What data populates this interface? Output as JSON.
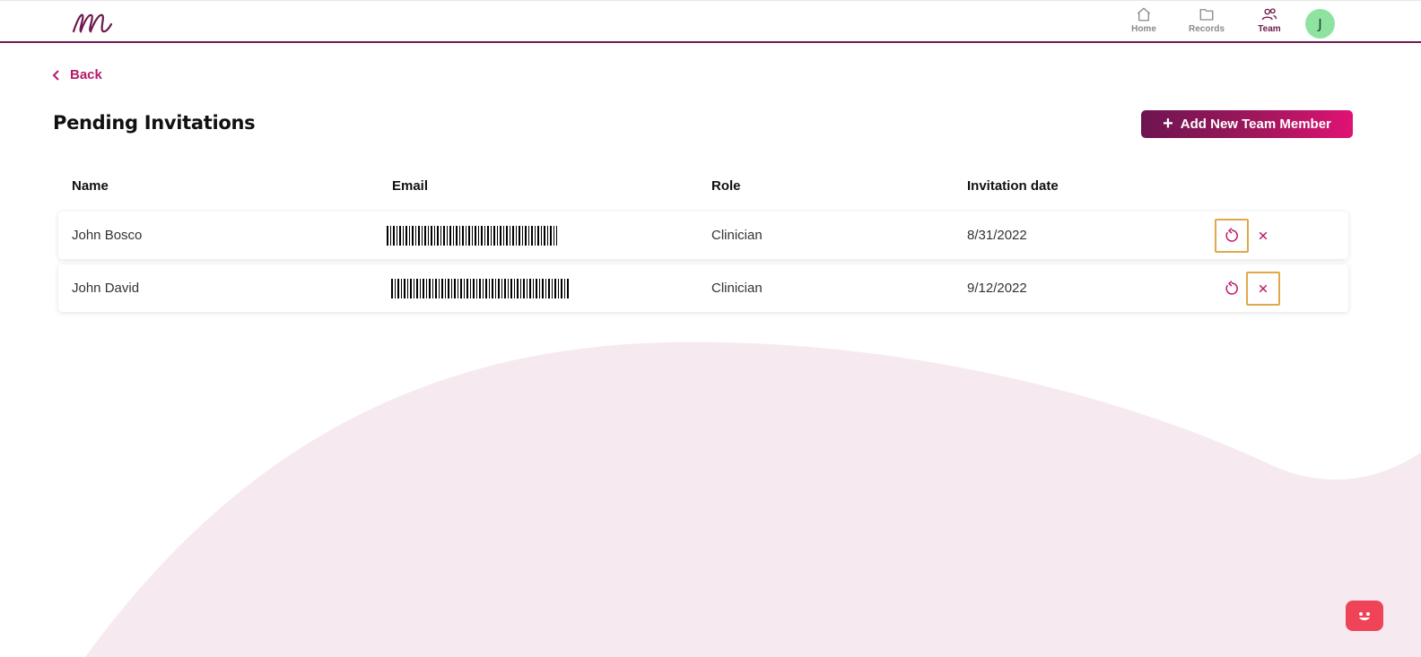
{
  "colors": {
    "brand_dark": "#6d1a4e",
    "brand_accent": "#b51a6b",
    "avatar_bg": "#8fe3a0",
    "highlight": "#e0a84a",
    "chat_bg": "#ef4358"
  },
  "nav": {
    "items": [
      {
        "label": "Home",
        "icon": "home-icon"
      },
      {
        "label": "Records",
        "icon": "folder-icon"
      },
      {
        "label": "Team",
        "icon": "team-icon",
        "active": true
      }
    ],
    "avatar_initial": "J"
  },
  "back_label": "Back",
  "page_title": "Pending Invitations",
  "add_button_label": "Add New Team Member",
  "table": {
    "columns": [
      "Name",
      "Email",
      "Role",
      "Invitation date"
    ],
    "rows": [
      {
        "name": "John Bosco",
        "role": "Clinician",
        "date": "8/31/2022"
      },
      {
        "name": "John David",
        "role": "Clinician",
        "date": "9/12/2022"
      }
    ]
  }
}
